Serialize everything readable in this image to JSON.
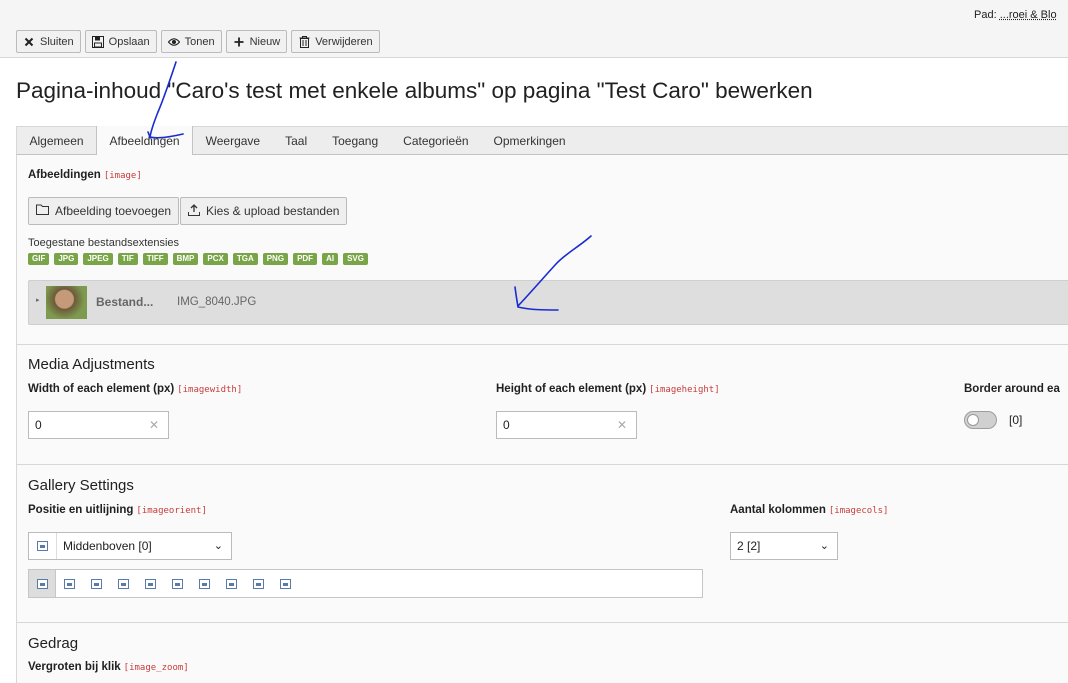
{
  "header": {
    "path_label": "Pad:",
    "path_value": "...roei & Blo",
    "buttons": [
      {
        "label": "Sluiten",
        "icon": "close-icon"
      },
      {
        "label": "Opslaan",
        "icon": "save-icon"
      },
      {
        "label": "Tonen",
        "icon": "eye-icon"
      },
      {
        "label": "Nieuw",
        "icon": "plus-icon"
      },
      {
        "label": "Verwijderen",
        "icon": "trash-icon"
      }
    ],
    "title": "Pagina-inhoud \"Caro's test met enkele albums\" op pagina \"Test Caro\" bewerken"
  },
  "tabs": [
    {
      "label": "Algemeen"
    },
    {
      "label": "Afbeeldingen",
      "active": true
    },
    {
      "label": "Weergave"
    },
    {
      "label": "Taal"
    },
    {
      "label": "Toegang"
    },
    {
      "label": "Categorieën"
    },
    {
      "label": "Opmerkingen"
    }
  ],
  "images": {
    "label": "Afbeeldingen",
    "code": "[image]",
    "add_button": "Afbeelding toevoegen",
    "upload_button": "Kies & upload bestanden",
    "allowed_label": "Toegestane bestandsextensies",
    "extensions": [
      "GIF",
      "JPG",
      "JPEG",
      "TIF",
      "TIFF",
      "BMP",
      "PCX",
      "TGA",
      "PNG",
      "PDF",
      "AI",
      "SVG"
    ],
    "file": {
      "title": "Bestand...",
      "name": "IMG_8040.JPG"
    }
  },
  "media": {
    "title": "Media Adjustments",
    "width_label": "Width of each element (px)",
    "width_code": "[imagewidth]",
    "width_value": "0",
    "height_label": "Height of each element (px)",
    "height_code": "[imageheight]",
    "height_value": "0",
    "border_label": "Border around ea",
    "border_toggle_value": "[0]"
  },
  "gallery": {
    "title": "Gallery Settings",
    "position_label": "Positie en uitlijning",
    "position_code": "[imageorient]",
    "position_selected": "Middenboven [0]",
    "columns_label": "Aantal kolommen",
    "columns_code": "[imagecols]",
    "columns_selected": "2 [2]"
  },
  "behaviour": {
    "title": "Gedrag",
    "zoom_label": "Vergroten bij klik",
    "zoom_code": "[image_zoom]"
  },
  "colors": {
    "accent": "#79a548",
    "code": "#c83c3c",
    "annotation": "#1a2bd0"
  }
}
